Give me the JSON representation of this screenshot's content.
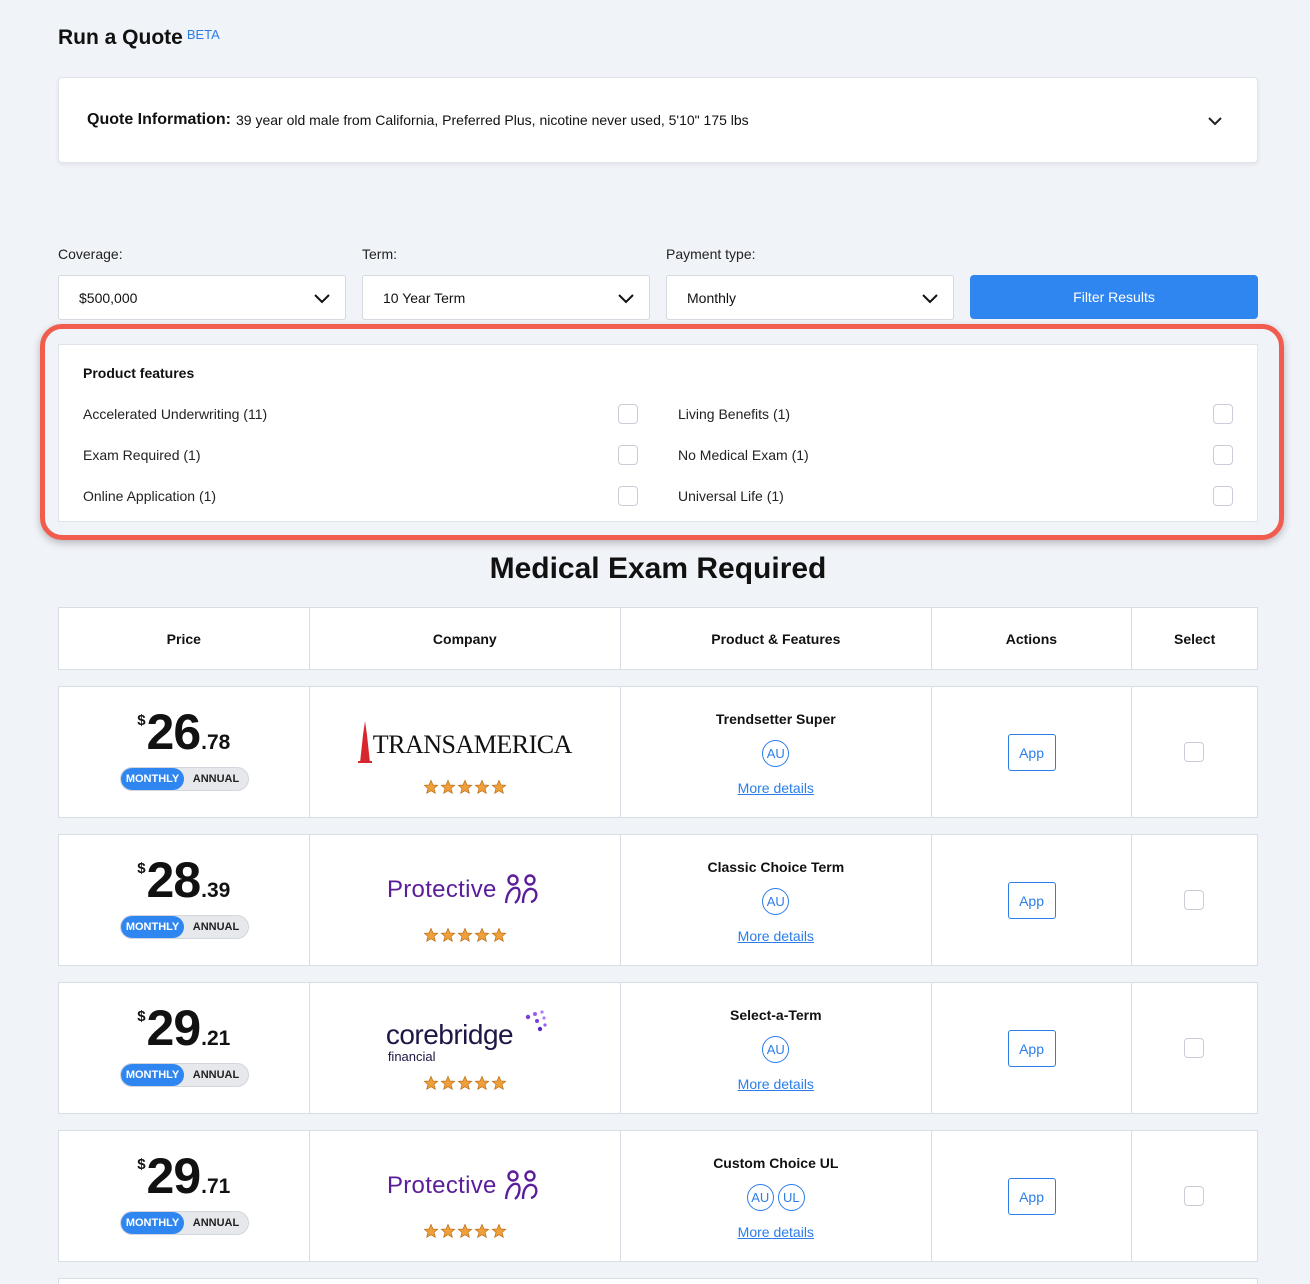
{
  "header": {
    "title": "Run a Quote",
    "badge": "BETA"
  },
  "quote_info": {
    "label": "Quote Information:",
    "value": "39 year old male from California, Preferred Plus, nicotine never used, 5'10\" 175 lbs"
  },
  "filters": {
    "coverage": {
      "label": "Coverage:",
      "value": "$500,000"
    },
    "term": {
      "label": "Term:",
      "value": "10 Year Term"
    },
    "payment": {
      "label": "Payment type:",
      "value": "Monthly"
    },
    "button": "Filter Results"
  },
  "features": {
    "title": "Product features",
    "items": [
      {
        "label": "Accelerated Underwriting (11)",
        "checked": false
      },
      {
        "label": "Living Benefits (1)",
        "checked": false
      },
      {
        "label": "Exam Required (1)",
        "checked": false
      },
      {
        "label": "No Medical Exam (1)",
        "checked": false
      },
      {
        "label": "Online Application (1)",
        "checked": false
      },
      {
        "label": "Universal Life (1)",
        "checked": false
      }
    ]
  },
  "section_title": "Medical Exam Required",
  "table": {
    "headers": [
      "Price",
      "Company",
      "Product & Features",
      "Actions",
      "Select"
    ],
    "rows": [
      {
        "currency": "$",
        "dollars": "26",
        "cents": ".78",
        "company": "TRANSAMERICA",
        "rating": 5,
        "product": "Trendsetter Super",
        "badges": [
          "AU"
        ],
        "more": "More details",
        "action": "App"
      },
      {
        "currency": "$",
        "dollars": "28",
        "cents": ".39",
        "company": "Protective",
        "rating": 5,
        "product": "Classic Choice Term",
        "badges": [
          "AU"
        ],
        "more": "More details",
        "action": "App"
      },
      {
        "currency": "$",
        "dollars": "29",
        "cents": ".21",
        "company": "corebridge",
        "company_sub": "financial",
        "rating": 5,
        "product": "Select-a-Term",
        "badges": [
          "AU"
        ],
        "more": "More details",
        "action": "App"
      },
      {
        "currency": "$",
        "dollars": "29",
        "cents": ".71",
        "company": "Protective",
        "rating": 5,
        "product": "Custom Choice UL",
        "badges": [
          "AU",
          "UL"
        ],
        "more": "More details",
        "action": "App"
      }
    ],
    "toggle": {
      "on": "MONTHLY",
      "off": "ANNUAL"
    }
  },
  "colors": {
    "accent": "#2f86f0",
    "highlight": "#f05d4f",
    "star": "#f0a03a",
    "protective": "#5b1d9a",
    "transamerica": "#d8262e"
  }
}
